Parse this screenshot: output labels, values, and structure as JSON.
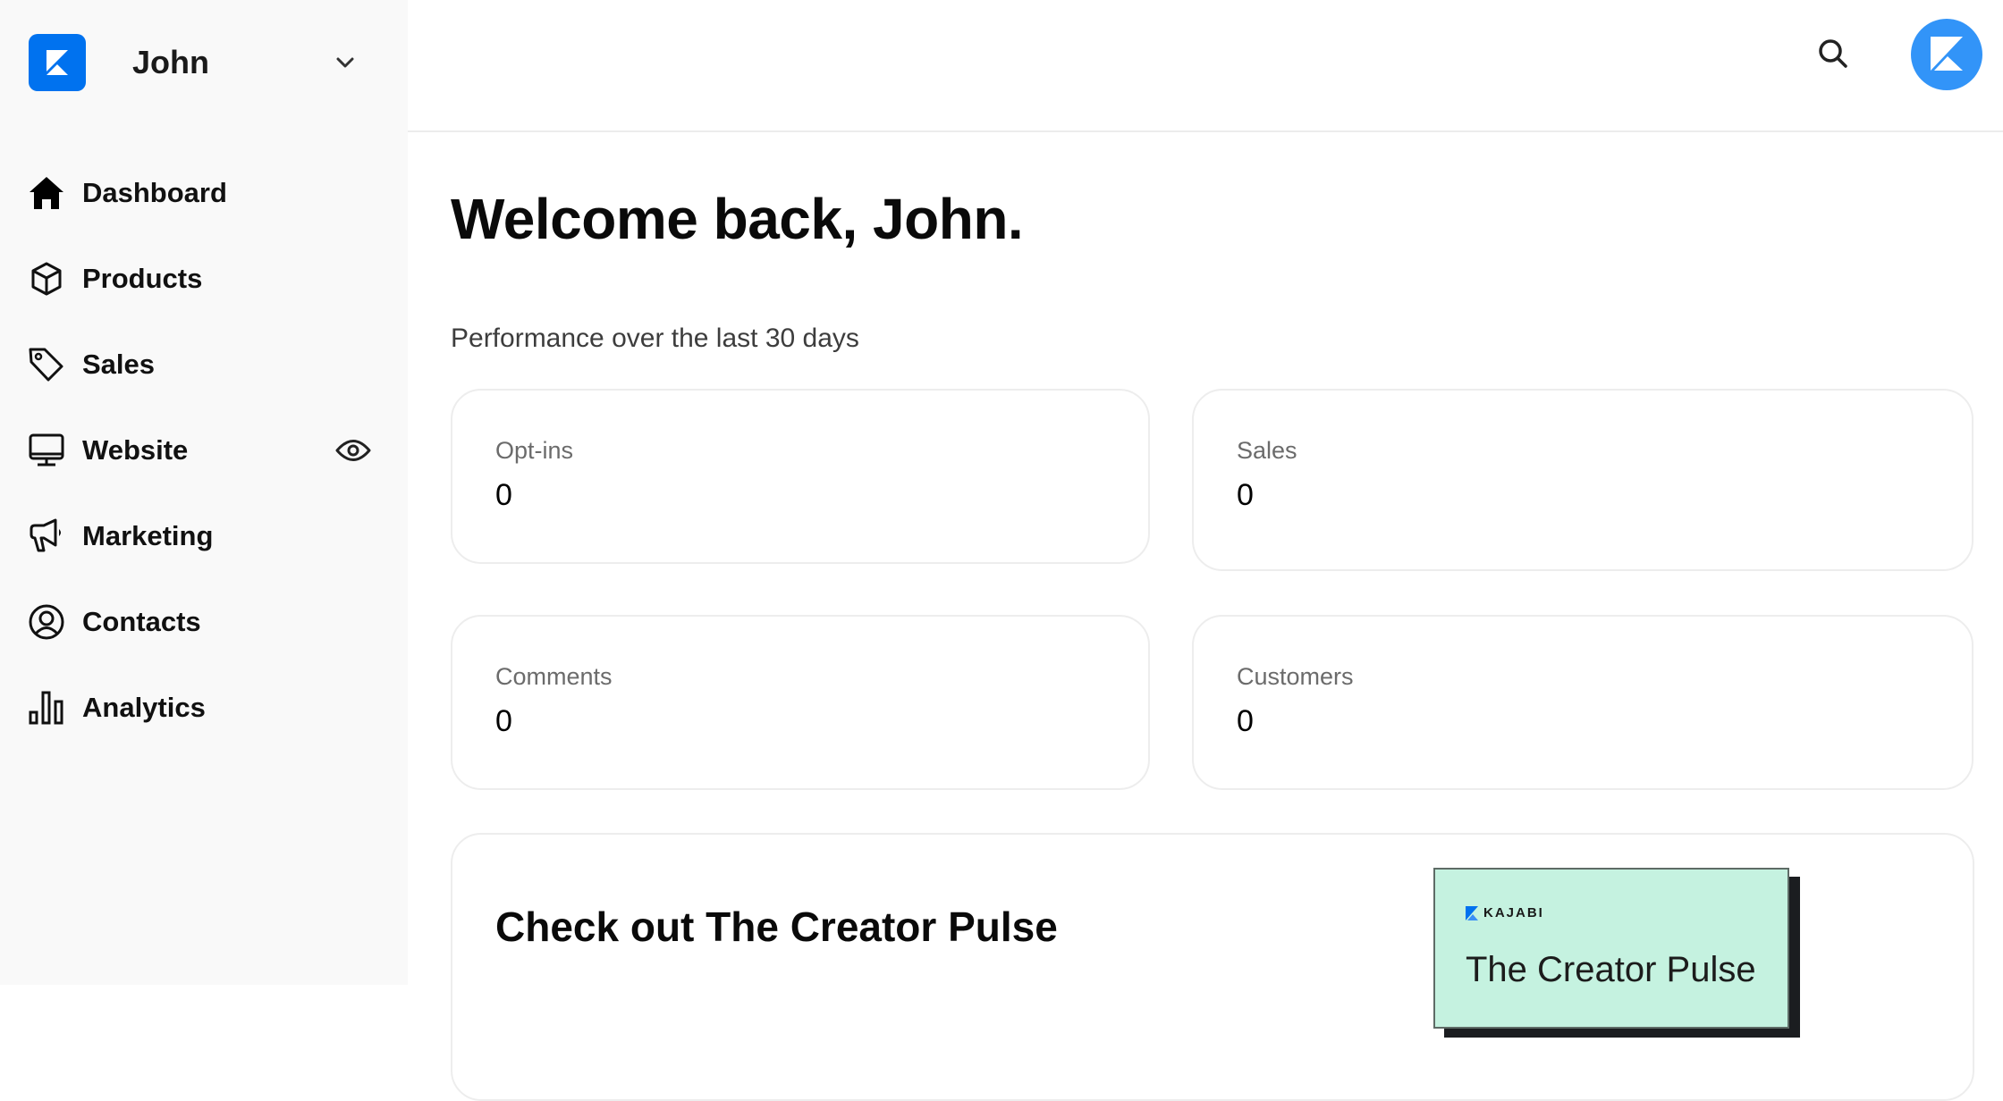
{
  "sidebar": {
    "account_name": "John",
    "logo_icon": "kajabi-logo-icon",
    "dropdown_icon": "chevron-down-icon",
    "items": [
      {
        "label": "Dashboard",
        "icon": "home-icon",
        "active": true
      },
      {
        "label": "Products",
        "icon": "box-icon"
      },
      {
        "label": "Sales",
        "icon": "tag-icon"
      },
      {
        "label": "Website",
        "icon": "monitor-icon",
        "extra_icon": "eye-icon"
      },
      {
        "label": "Marketing",
        "icon": "megaphone-icon"
      },
      {
        "label": "Contacts",
        "icon": "user-circle-icon"
      },
      {
        "label": "Analytics",
        "icon": "bar-chart-icon"
      }
    ]
  },
  "topbar": {
    "search_icon": "search-icon",
    "avatar_icon": "kajabi-logo-icon"
  },
  "main": {
    "welcome": "Welcome back, John.",
    "subtitle": "Performance over the last 30 days",
    "metrics": [
      {
        "label": "Opt-ins",
        "value": "0"
      },
      {
        "label": "Sales",
        "value": "0"
      },
      {
        "label": "Comments",
        "value": "0"
      },
      {
        "label": "Customers",
        "value": "0"
      }
    ],
    "promo": {
      "title": "Check out The Creator Pulse",
      "thumb_brand": "KAJABI",
      "thumb_title": "The Creator Pulse"
    }
  },
  "colors": {
    "brand_blue": "#0072ef",
    "avatar_blue": "#3294f8",
    "sidebar_bg": "#f9f9f9",
    "promo_thumb_bg": "#c5f2e0"
  }
}
